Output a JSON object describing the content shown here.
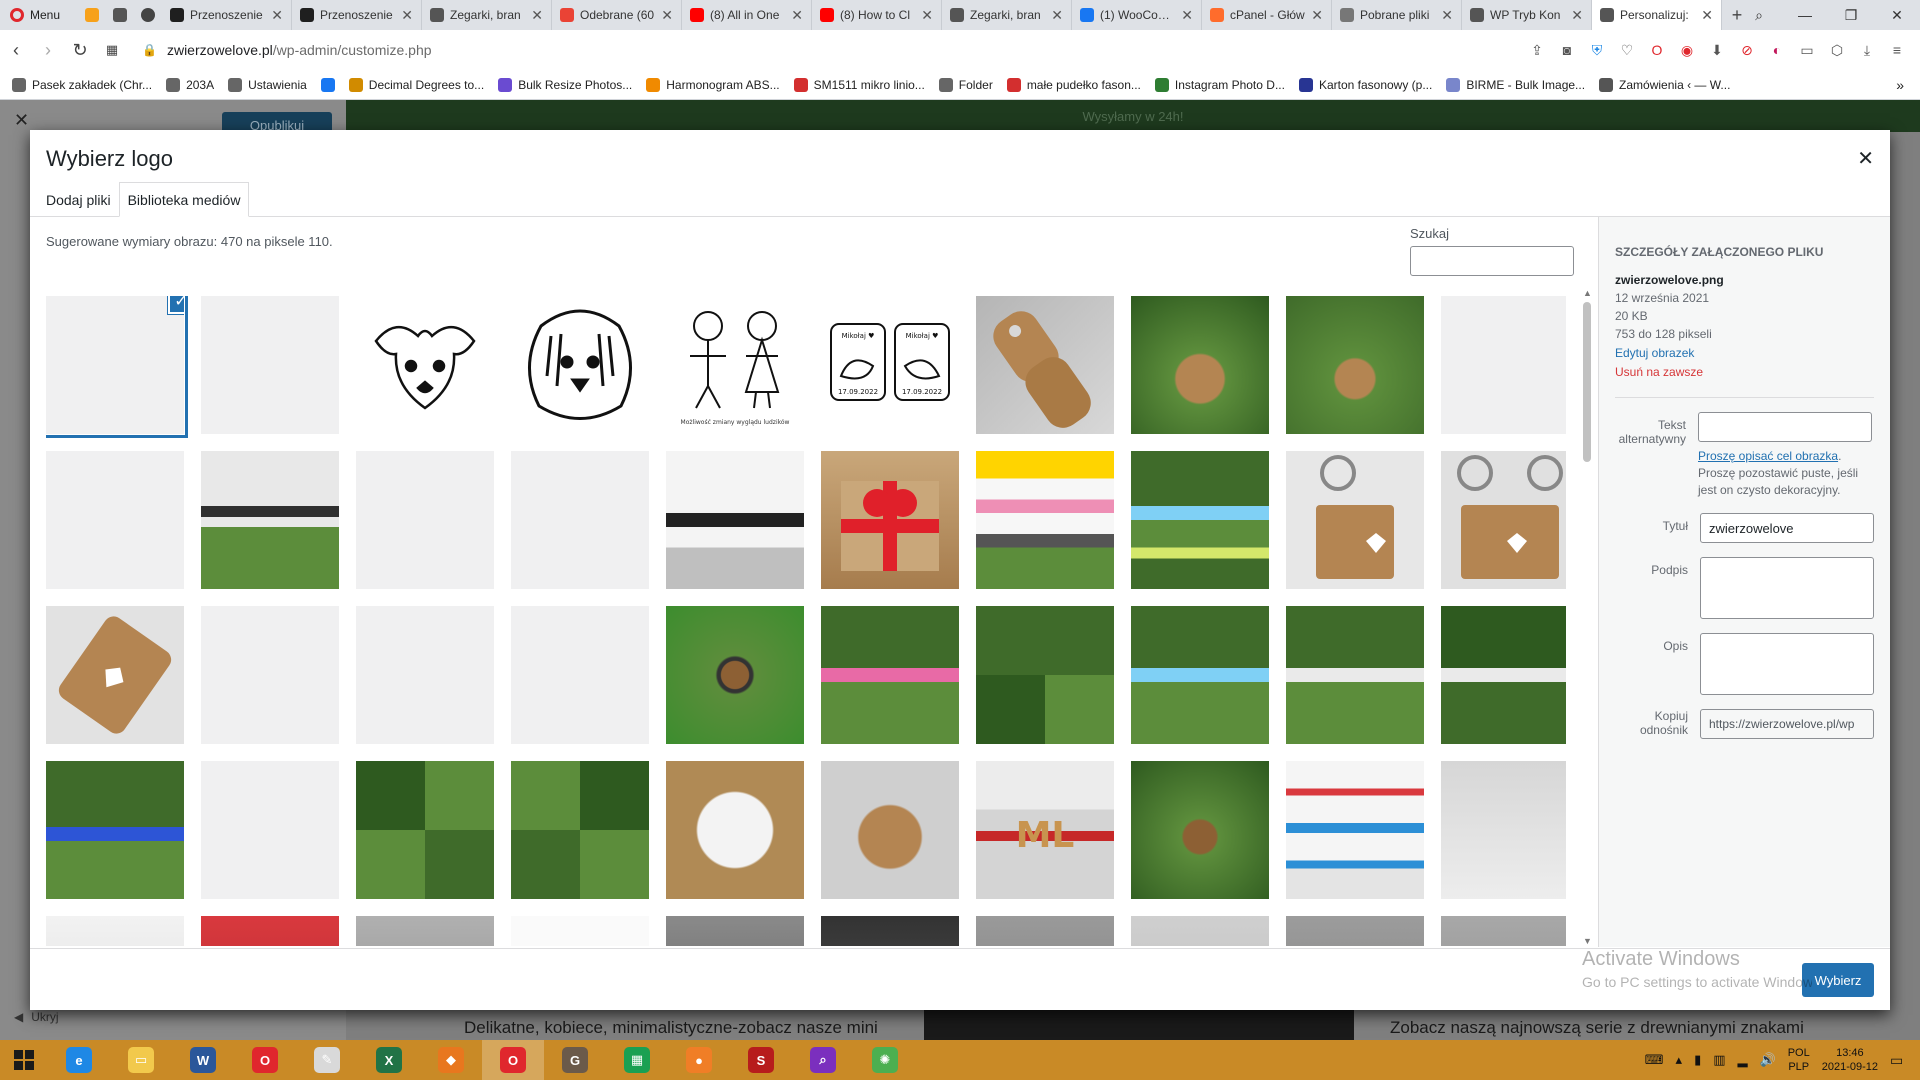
{
  "browser": {
    "menu_label": "Menu",
    "tabs": [
      {
        "label": "Przenoszenie",
        "color": "#1f1f1f"
      },
      {
        "label": "Przenoszenie",
        "color": "#1f1f1f"
      },
      {
        "label": "Zegarki, bran",
        "color": "#555555"
      },
      {
        "label": "Odebrane (60",
        "color": "#ea4335"
      },
      {
        "label": "(8) All in One",
        "color": "#ff0000"
      },
      {
        "label": "(8) How to Cl",
        "color": "#ff0000"
      },
      {
        "label": "Zegarki, bran",
        "color": "#555555"
      },
      {
        "label": "(1) WooComm",
        "color": "#1877f2"
      },
      {
        "label": "cPanel - Głów",
        "color": "#ff6c2c"
      },
      {
        "label": "Pobrane pliki",
        "color": "#777777"
      },
      {
        "label": "WP Tryb Kon",
        "color": "#555555"
      },
      {
        "label": "Personalizuj:",
        "color": "#555555",
        "active": true
      }
    ],
    "url_domain": "zwierzowelove.pl",
    "url_path": "/wp-admin/customize.php",
    "bookmarks": [
      {
        "label": "Pasek zakładek (Chr...",
        "color": "#666666"
      },
      {
        "label": "203A",
        "color": "#666666"
      },
      {
        "label": "Ustawienia",
        "color": "#666666"
      },
      {
        "label": "",
        "color": "#1877f2"
      },
      {
        "label": "Decimal Degrees to...",
        "color": "#d18b00"
      },
      {
        "label": "Bulk Resize Photos...",
        "color": "#6a4bd1"
      },
      {
        "label": "Harmonogram ABS...",
        "color": "#f08a00"
      },
      {
        "label": "SM1511 mikro linio...",
        "color": "#d32f2f"
      },
      {
        "label": "Folder",
        "color": "#666666"
      },
      {
        "label": "małe pudełko fason...",
        "color": "#d32f2f"
      },
      {
        "label": "Instagram Photo D...",
        "color": "#2e7d32"
      },
      {
        "label": "Karton fasonowy (p...",
        "color": "#283593"
      },
      {
        "label": "BIRME - Bulk Image...",
        "color": "#7986cb"
      },
      {
        "label": "Zamówienia ‹ — W...",
        "color": "#555555"
      }
    ]
  },
  "customizer": {
    "publish_label": "Opublikuj",
    "banner": "Wysyłamy w 24h!",
    "preview_text_left": "Delikatne, kobiece, minimalistyczne-zobacz nasze mini",
    "preview_text_right": "Zobacz naszą najnowszą serie z drewnianymi znakami",
    "hide_label": "Ukryj"
  },
  "modal": {
    "title": "Wybierz logo",
    "tabs": [
      "Dodaj pliki",
      "Biblioteka mediów"
    ],
    "suggested": "Sugerowane wymiary obrazu: 470 na piksele 110.",
    "search_label": "Szukaj",
    "select_button": "Wybierz",
    "thumbnails": [
      {
        "kind": "blank",
        "selected": true
      },
      {
        "kind": "blank"
      },
      {
        "kind": "dog1"
      },
      {
        "kind": "dog2"
      },
      {
        "kind": "people"
      },
      {
        "kind": "birds"
      },
      {
        "kind": "wood"
      },
      {
        "kind": "pendant"
      },
      {
        "kind": "pendant2"
      },
      {
        "kind": "blank"
      },
      {
        "kind": "blank"
      },
      {
        "kind": "grass-card"
      },
      {
        "kind": "blank"
      },
      {
        "kind": "blank"
      },
      {
        "kind": "bracelet-card"
      },
      {
        "kind": "gift"
      },
      {
        "kind": "bracelets-pink"
      },
      {
        "kind": "bracelets-blue"
      },
      {
        "kind": "keychain"
      },
      {
        "kind": "keychain2"
      },
      {
        "kind": "wood-heart"
      },
      {
        "kind": "blank"
      },
      {
        "kind": "blank"
      },
      {
        "kind": "blank"
      },
      {
        "kind": "green-bracelet"
      },
      {
        "kind": "pink-green"
      },
      {
        "kind": "collage"
      },
      {
        "kind": "blue-green"
      },
      {
        "kind": "white-green"
      },
      {
        "kind": "dark-green"
      },
      {
        "kind": "blue-bracelet"
      },
      {
        "kind": "blank"
      },
      {
        "kind": "collage2"
      },
      {
        "kind": "collage3"
      },
      {
        "kind": "box"
      },
      {
        "kind": "keyring-mount"
      },
      {
        "kind": "ml-letters"
      },
      {
        "kind": "knot"
      },
      {
        "kind": "bracelet-cards"
      },
      {
        "kind": "envelope"
      },
      {
        "kind": "row5a"
      },
      {
        "kind": "row5b"
      },
      {
        "kind": "row5c"
      },
      {
        "kind": "row5d"
      },
      {
        "kind": "row5e"
      },
      {
        "kind": "row5f"
      },
      {
        "kind": "row5g"
      },
      {
        "kind": "row5h"
      },
      {
        "kind": "row5i"
      },
      {
        "kind": "row5j"
      }
    ],
    "details": {
      "heading": "Szczegóły załączonego pliku",
      "filename": "zwierzowelove.png",
      "date": "12 września 2021",
      "size": "20 KB",
      "dimensions": "753 do 128 pikseli",
      "edit_link": "Edytuj obrazek",
      "delete_link": "Usuń na zawsze",
      "alt_label": "Tekst alternatywny",
      "alt_help_link": "Proszę opisać cel obrazka",
      "alt_help_text": "Proszę pozostawić puste, jeśli jest on czysto dekoracyjny.",
      "title_label": "Tytuł",
      "title_value": "zwierzowelove",
      "caption_label": "Podpis",
      "description_label": "Opis",
      "copy_label": "Kopiuj odnośnik",
      "copy_value": "https://zwierzowelove.pl/wp"
    }
  },
  "windows": {
    "activate_title": "Activate Windows",
    "activate_sub": "Go to PC settings to activate Windows.",
    "lang1": "POL",
    "lang2": "PLP",
    "time": "13:46",
    "date": "2021-09-12",
    "taskbar_apps": [
      {
        "name": "ie",
        "color": "#1e88e5",
        "label": "e"
      },
      {
        "name": "explorer",
        "color": "#f2c94c",
        "label": "▭"
      },
      {
        "name": "word",
        "color": "#2b579a",
        "label": "W"
      },
      {
        "name": "opera",
        "color": "#e0272d",
        "label": "O"
      },
      {
        "name": "paint",
        "color": "#d9d9d9",
        "label": "✎"
      },
      {
        "name": "excel",
        "color": "#217346",
        "label": "X"
      },
      {
        "name": "app-orange",
        "color": "#e8771e",
        "label": "◆"
      },
      {
        "name": "opera-active",
        "color": "#e0272d",
        "label": "O",
        "active": true
      },
      {
        "name": "gimp",
        "color": "#6b5a4a",
        "label": "G"
      },
      {
        "name": "calculator",
        "color": "#1aa052",
        "label": "▦"
      },
      {
        "name": "app-circle",
        "color": "#f07e26",
        "label": "●"
      },
      {
        "name": "app-red",
        "color": "#b71c1c",
        "label": "S"
      },
      {
        "name": "search-app",
        "color": "#7b2fbe",
        "label": "⌕"
      },
      {
        "name": "app-green",
        "color": "#4caf50",
        "label": "✺"
      }
    ]
  }
}
